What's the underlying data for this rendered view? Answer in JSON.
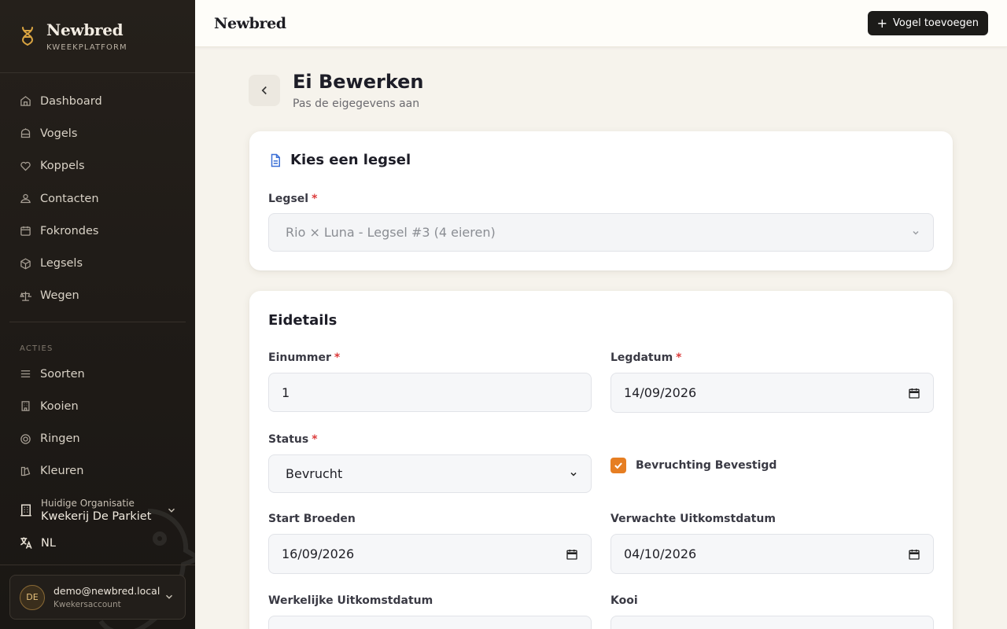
{
  "app": {
    "brand_title": "Newbred",
    "brand_subtitle": "KWEEKPLATFORM",
    "top_title": "Newbred",
    "add_button_label": "Vogel toevoegen"
  },
  "sidebar": {
    "nav": [
      {
        "label": "Dashboard",
        "icon": "home-icon"
      },
      {
        "label": "Vogels",
        "icon": "birdcage-icon"
      },
      {
        "label": "Koppels",
        "icon": "heart-icon"
      },
      {
        "label": "Contacten",
        "icon": "contacts-icon"
      },
      {
        "label": "Fokrondes",
        "icon": "calendar-icon"
      },
      {
        "label": "Legsels",
        "icon": "box-icon"
      },
      {
        "label": "Wegen",
        "icon": "scale-icon"
      }
    ],
    "actions_label": "ACTIES",
    "actions": [
      {
        "label": "Soorten",
        "icon": "list-icon"
      },
      {
        "label": "Kooien",
        "icon": "building-icon"
      },
      {
        "label": "Ringen",
        "icon": "ring-icon"
      },
      {
        "label": "Kleuren",
        "icon": "palette-icon"
      }
    ],
    "org_label": "Huidige Organisatie",
    "org_name": "Kwekerij De Parkiet",
    "language": "NL",
    "user_initials": "DE",
    "user_email": "demo@newbred.local",
    "user_role": "Kwekersaccount"
  },
  "page": {
    "title": "Ei Bewerken",
    "subtitle": "Pas de eigegevens aan"
  },
  "clutch_card": {
    "title": "Kies een legsel",
    "legsel_label": "Legsel",
    "legsel_value": "Rio × Luna - Legsel #3 (4 eieren)"
  },
  "egg_card": {
    "title": "Eidetails",
    "einummer_label": "Einummer",
    "einummer_value": "1",
    "legdatum_label": "Legdatum",
    "legdatum_value": "14/09/2026",
    "status_label": "Status",
    "status_value": "Bevrucht",
    "fertility_label": "Bevruchting Bevestigd",
    "fertility_checked": true,
    "start_label": "Start Broeden",
    "start_value": "16/09/2026",
    "expected_label": "Verwachte Uitkomstdatum",
    "expected_value": "04/10/2026",
    "actual_label": "Werkelijke Uitkomstdatum",
    "cage_label": "Kooi"
  },
  "colors": {
    "sidebar_bg": "#221d19",
    "accent_orange": "#e67e22",
    "doc_icon_blue": "#3b6fd6",
    "required_red": "#dc3b3b"
  }
}
